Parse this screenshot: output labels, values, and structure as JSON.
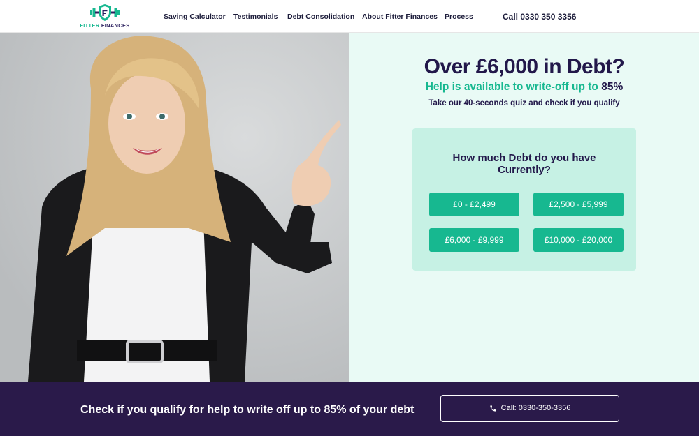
{
  "brand": {
    "name_part1": "FITTER",
    "name_part2": "FINANCES",
    "primary_color": "#17b890",
    "dark_color": "#22184a"
  },
  "nav": {
    "links": [
      "Saving Calculator",
      "Testimonials",
      "Debt Consolidation",
      "About Fitter Finances",
      "Process"
    ],
    "call": "Call 0330 350 3356"
  },
  "hero": {
    "headline": "Over £6,000 in Debt?",
    "subhead_text": "Help is available to write-off up to",
    "subhead_pct": "85%",
    "tagline": "Take our 40-seconds quiz and check if you qualify"
  },
  "quiz": {
    "question": "How much Debt do you have Currently?",
    "options": [
      "£0 - £2,499",
      "£2,500 - £5,999",
      "£6,000 - £9,999",
      "£10,000 - £20,000"
    ]
  },
  "bar": {
    "text": "Check if you qualify for help to write off up to 85% of your debt",
    "button": "Call: 0330-350-3356",
    "background": "#2a1a4a"
  },
  "icons": {
    "logo": "dumbbell-shield-icon",
    "phone": "phone-icon"
  }
}
